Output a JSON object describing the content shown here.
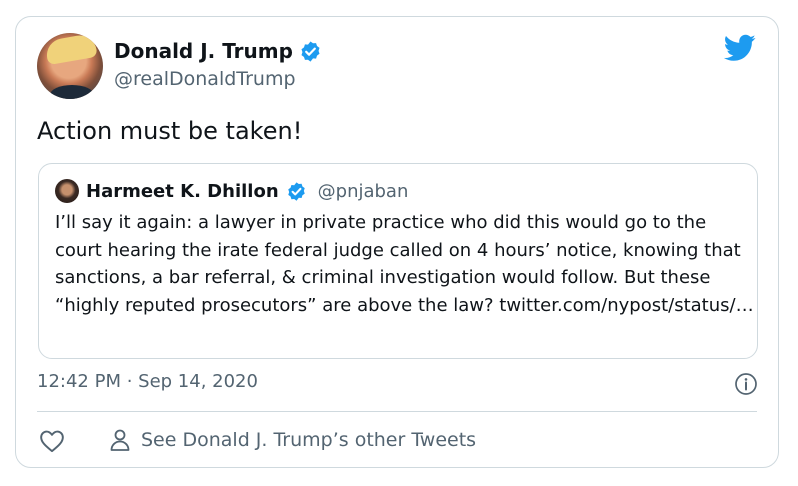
{
  "tweet": {
    "author_name": "Donald J. Trump",
    "author_handle": "@realDonaldTrump",
    "text": "Action must be taken!",
    "timestamp": "12:42 PM · Sep 14, 2020",
    "see_other": "See Donald J. Trump’s other Tweets"
  },
  "quoted": {
    "author_name": "Harmeet K. Dhillon",
    "author_handle": "@pnjaban",
    "text": "I’ll say it again: a lawyer in private practice who did this would go to the court hearing the irate federal judge called on 4 hours’ notice, knowing that sanctions, a bar referral, & criminal investigation would follow. But these “highly reputed prosecutors” are above the law? twitter.com/nypost/status/…"
  },
  "icons": {
    "brand": "twitter-bird-icon",
    "verified": "verified-badge-icon",
    "info": "info-icon",
    "like": "heart-icon",
    "profile": "person-icon"
  },
  "colors": {
    "brand_blue": "#1d9bf0",
    "secondary_text": "#536471",
    "border": "#cfd9de"
  }
}
